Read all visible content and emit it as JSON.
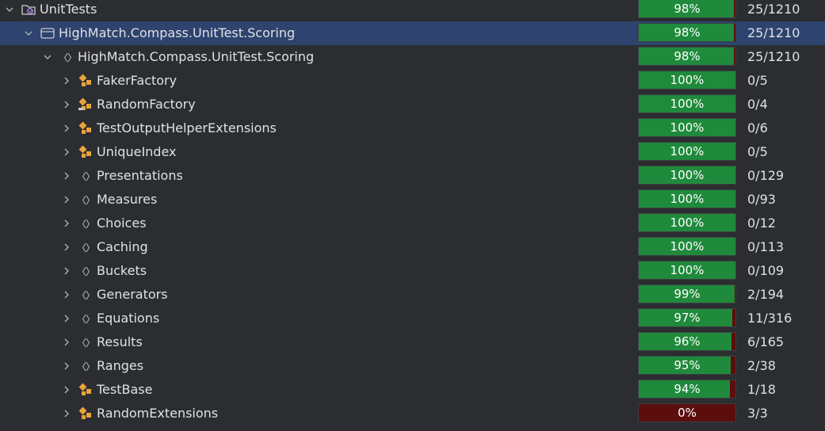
{
  "colors": {
    "background": "#2b2d30",
    "selected_row": "#2e436e",
    "covered": "#1f8a3b",
    "uncovered": "#5c0d0d",
    "class_icon": "#e8a33d"
  },
  "rows": [
    {
      "label": "UnitTests",
      "icon": "project-icon",
      "pct": "98%",
      "fill": 0.98,
      "count": "25/1210",
      "expanded": true,
      "level": 0,
      "selected": false
    },
    {
      "label": "HighMatch.Compass.UnitTest.Scoring",
      "icon": "assembly-icon",
      "pct": "98%",
      "fill": 0.98,
      "count": "25/1210",
      "expanded": true,
      "level": 1,
      "selected": true
    },
    {
      "label": "HighMatch.Compass.UnitTest.Scoring",
      "icon": "namespace-icon",
      "pct": "98%",
      "fill": 0.98,
      "count": "25/1210",
      "expanded": true,
      "level": 2,
      "selected": false
    },
    {
      "label": "FakerFactory",
      "icon": "class-icon",
      "pct": "100%",
      "fill": 1.0,
      "count": "0/5",
      "expanded": false,
      "level": 3,
      "selected": false
    },
    {
      "label": "RandomFactory",
      "icon": "static-class-icon",
      "pct": "100%",
      "fill": 1.0,
      "count": "0/4",
      "expanded": false,
      "level": 3,
      "selected": false
    },
    {
      "label": "TestOutputHelperExtensions",
      "icon": "class-icon",
      "pct": "100%",
      "fill": 1.0,
      "count": "0/6",
      "expanded": false,
      "level": 3,
      "selected": false
    },
    {
      "label": "UniqueIndex",
      "icon": "class-icon",
      "pct": "100%",
      "fill": 1.0,
      "count": "0/5",
      "expanded": false,
      "level": 3,
      "selected": false
    },
    {
      "label": "Presentations",
      "icon": "namespace-icon",
      "pct": "100%",
      "fill": 1.0,
      "count": "0/129",
      "expanded": false,
      "level": 3,
      "selected": false
    },
    {
      "label": "Measures",
      "icon": "namespace-icon",
      "pct": "100%",
      "fill": 1.0,
      "count": "0/93",
      "expanded": false,
      "level": 3,
      "selected": false
    },
    {
      "label": "Choices",
      "icon": "namespace-icon",
      "pct": "100%",
      "fill": 1.0,
      "count": "0/12",
      "expanded": false,
      "level": 3,
      "selected": false
    },
    {
      "label": "Caching",
      "icon": "namespace-icon",
      "pct": "100%",
      "fill": 1.0,
      "count": "0/113",
      "expanded": false,
      "level": 3,
      "selected": false
    },
    {
      "label": "Buckets",
      "icon": "namespace-icon",
      "pct": "100%",
      "fill": 1.0,
      "count": "0/109",
      "expanded": false,
      "level": 3,
      "selected": false
    },
    {
      "label": "Generators",
      "icon": "namespace-icon",
      "pct": "99%",
      "fill": 0.99,
      "count": "2/194",
      "expanded": false,
      "level": 3,
      "selected": false
    },
    {
      "label": "Equations",
      "icon": "namespace-icon",
      "pct": "97%",
      "fill": 0.97,
      "count": "11/316",
      "expanded": false,
      "level": 3,
      "selected": false
    },
    {
      "label": "Results",
      "icon": "namespace-icon",
      "pct": "96%",
      "fill": 0.96,
      "count": "6/165",
      "expanded": false,
      "level": 3,
      "selected": false
    },
    {
      "label": "Ranges",
      "icon": "namespace-icon",
      "pct": "95%",
      "fill": 0.95,
      "count": "2/38",
      "expanded": false,
      "level": 3,
      "selected": false
    },
    {
      "label": "TestBase",
      "icon": "class-icon",
      "pct": "94%",
      "fill": 0.94,
      "count": "1/18",
      "expanded": false,
      "level": 3,
      "selected": false
    },
    {
      "label": "RandomExtensions",
      "icon": "class-icon",
      "pct": "0%",
      "fill": 0.0,
      "count": "3/3",
      "expanded": false,
      "level": 3,
      "selected": false
    }
  ]
}
